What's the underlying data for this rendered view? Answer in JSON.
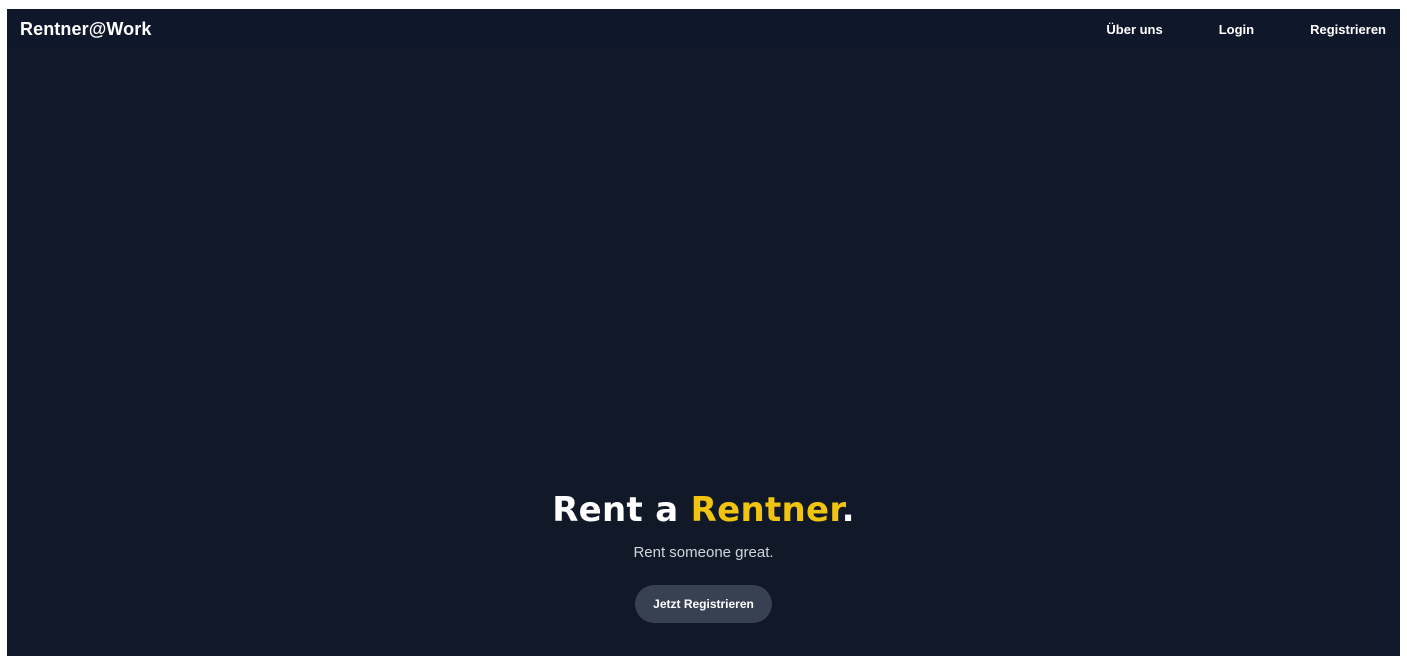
{
  "nav": {
    "brand": "Rentner@Work",
    "links": [
      "Über uns",
      "Login",
      "Registrieren"
    ]
  },
  "hero": {
    "headline_part1": "Rent a ",
    "headline_accent": "Rentner",
    "headline_end": ".",
    "subtitle": "Rent someone great.",
    "cta_label": "Jetzt Registrieren"
  },
  "colors": {
    "background": "#111827",
    "navbar": "#0f172a",
    "accent": "#f1c40f",
    "button": "#374151"
  }
}
